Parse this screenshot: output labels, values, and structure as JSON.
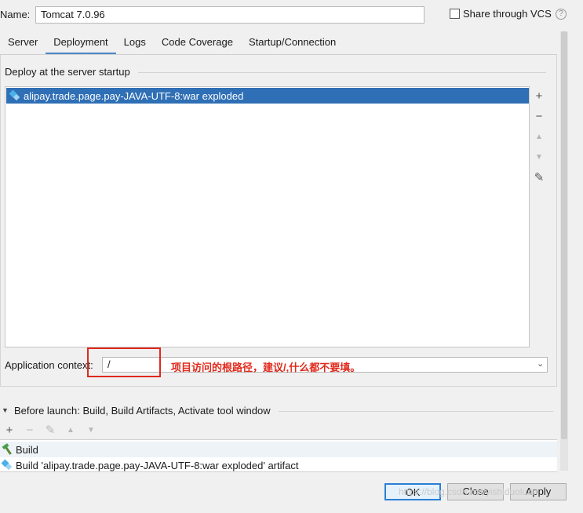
{
  "name_label": "Name:",
  "name_value": "Tomcat 7.0.96",
  "share_label": "Share through VCS",
  "help_glyph": "?",
  "tabs": [
    {
      "label": "Server"
    },
    {
      "label": "Deployment"
    },
    {
      "label": "Logs"
    },
    {
      "label": "Code Coverage"
    },
    {
      "label": "Startup/Connection"
    }
  ],
  "deploy_title": "Deploy at the server startup",
  "deploy_items": [
    {
      "label": "alipay.trade.page.pay-JAVA-UTF-8:war exploded",
      "icon": "artifact-icon"
    }
  ],
  "side_tools": {
    "add": "+",
    "remove": "−",
    "up": "▲",
    "down": "▼",
    "edit": "✎"
  },
  "app_context": {
    "label": "Application context:",
    "value": "/",
    "annotation": "项目访问的根路径，建议/,什么都不要填。",
    "annotation_color": "#e0291c"
  },
  "before_launch": {
    "title": "Before launch: Build, Build Artifacts, Activate tool window",
    "tools": {
      "add": "+",
      "remove": "−",
      "edit": "✎",
      "up": "▲",
      "down": "▼"
    },
    "items": [
      {
        "label": "Build",
        "icon": "hammer-icon"
      },
      {
        "label": "Build 'alipay.trade.page.pay-JAVA-UTF-8:war exploded' artifact",
        "icon": "artifact-icon"
      }
    ]
  },
  "buttons": {
    "ok": "OK",
    "close": "Close",
    "apply": "Apply"
  },
  "watermark": "https://blog.csdn.net/yishiduoluan",
  "colors": {
    "selection": "#2f6fb5",
    "tab_accent": "#4a88c7",
    "annotation_red": "#e0291c"
  }
}
